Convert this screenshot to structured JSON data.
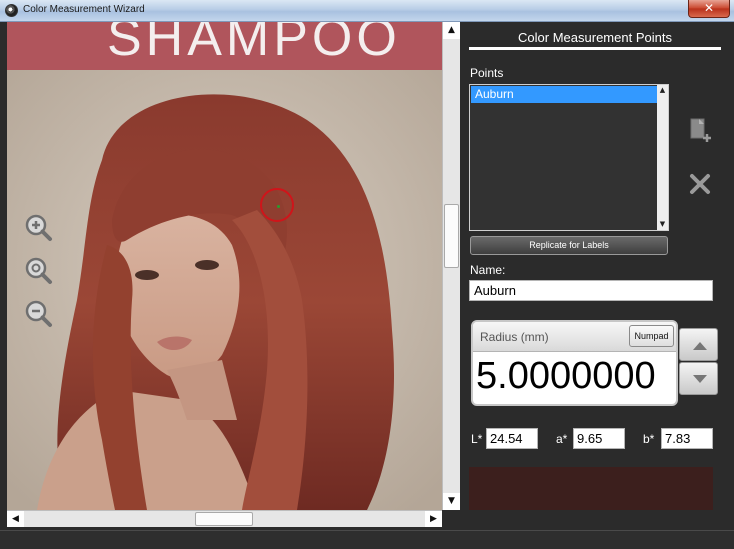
{
  "window": {
    "title": "Color Measurement Wizard",
    "close_glyph": "✕"
  },
  "image": {
    "banner_text": "SHAMPOO"
  },
  "zoom": {
    "in_icon": "zoom-in-icon",
    "fit_icon": "zoom-fit-icon",
    "out_icon": "zoom-out-icon"
  },
  "panel": {
    "header": "Color Measurement Points",
    "points_label": "Points",
    "points": [
      "Auburn"
    ],
    "replicate_label": "Replicate for Labels",
    "name_label": "Name:",
    "name_value": "Auburn",
    "radius_label": "Radius (mm)",
    "numpad_label": "Numpad",
    "radius_value": "5.0000000",
    "lab": {
      "l_label": "L*",
      "l_value": "24.54",
      "a_label": "a*",
      "a_value": "9.65",
      "b_label": "b*",
      "b_value": "7.83"
    },
    "swatch_color": "#3c1f1d"
  },
  "colors": {
    "accent_selection": "#3399ff",
    "banner": "#b0555c",
    "target_ring": "#d0141a"
  }
}
